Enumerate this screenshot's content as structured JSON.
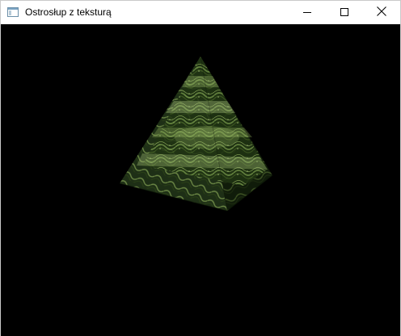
{
  "window": {
    "title": "Ostrosłup z teksturą",
    "icon": "window-app-icon"
  },
  "controls": {
    "minimize_icon": "minimize-icon",
    "maximize_icon": "maximize-icon",
    "close_icon": "close-icon"
  },
  "scene": {
    "background_color": "#000000",
    "object": "textured-pyramid",
    "texture": "green-fern-foliage"
  }
}
